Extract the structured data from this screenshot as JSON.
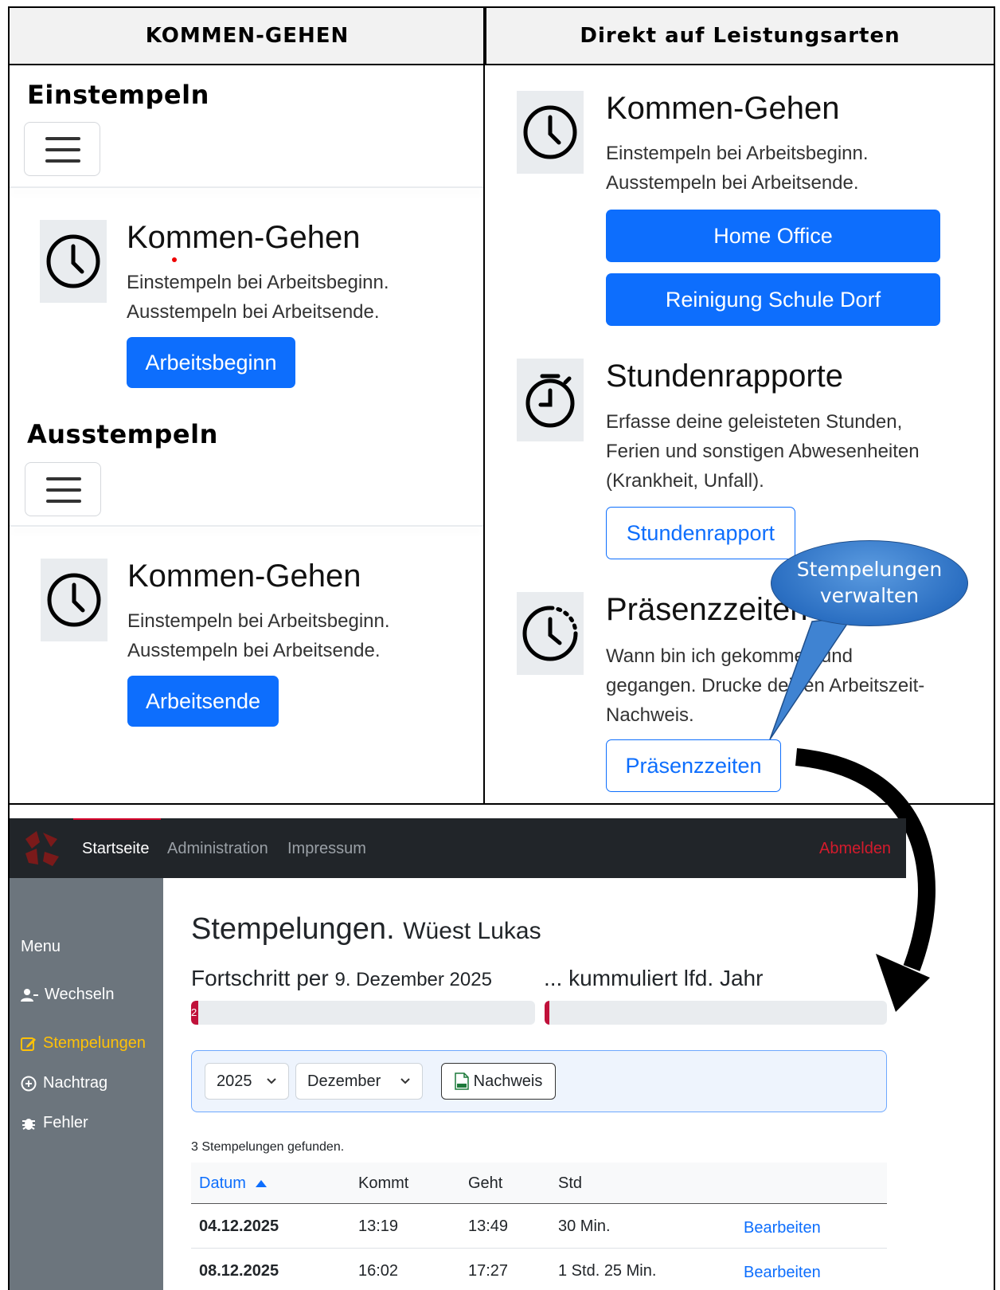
{
  "header": {
    "left": "KOMMEN-GEHEN",
    "right": "Direkt auf Leistungsarten"
  },
  "left_panel": {
    "clock_in": {
      "section_title": "Einstempeln",
      "card_title": "Kommen-Gehen",
      "text_line1": "Einstempeln bei Arbeitsbeginn.",
      "text_line2": "Ausstempeln bei Arbeitsende.",
      "button": "Arbeitsbeginn"
    },
    "clock_out": {
      "section_title": "Ausstempeln",
      "card_title": "Kommen-Gehen",
      "text_line1": "Einstempeln bei Arbeitsbeginn.",
      "text_line2": "Ausstempeln bei Arbeitsende.",
      "button": "Arbeitsende"
    }
  },
  "right_panel": {
    "kommen_gehen": {
      "title": "Kommen-Gehen",
      "text_line1": "Einstempeln bei Arbeitsbeginn.",
      "text_line2": "Ausstempeln bei Arbeitsende.",
      "button1": "Home Office",
      "button2": "Reinigung Schule Dorf"
    },
    "stundenrapporte": {
      "title": "Stundenrapporte",
      "text_line1": "Erfasse deine geleisteten Stunden,",
      "text_line2": "Ferien und sonstigen Abwesenheiten",
      "text_line3": "(Krankheit, Unfall).",
      "button": "Stundenrapport"
    },
    "praesenzzeiten": {
      "title": "Präsenzzeiten",
      "text_line1": "Wann bin ich gekommen und",
      "text_line2": "gegangen. Drucke deinen Arbeitszeit-",
      "text_line3": "Nachweis.",
      "button": "Präsenzzeiten"
    },
    "callout": {
      "line1": "Stempelungen",
      "line2": "verwalten"
    }
  },
  "app": {
    "nav": {
      "items": [
        "Startseite",
        "Administration",
        "Impressum"
      ],
      "logout": "Abmelden"
    },
    "sidebar": {
      "menu_label": "Menu",
      "items": [
        {
          "label": "Wechseln",
          "icon": "user-switch-icon"
        },
        {
          "label": "Stempelungen",
          "icon": "edit-icon"
        },
        {
          "label": "Nachtrag",
          "icon": "plus-circle-icon"
        },
        {
          "label": "Fehler",
          "icon": "bug-icon"
        }
      ]
    },
    "title": "Stempelungen.",
    "user": "Wüest Lukas",
    "progress": {
      "label": "Fortschritt per",
      "date": "9. Dezember 2025",
      "cumulative_label": "... kummuliert lfd. Jahr",
      "bar1_text": "2",
      "bar1_fraction": 0.02,
      "bar2_fraction": 0.01
    },
    "filter": {
      "year": "2025",
      "month": "Dezember",
      "export_button": "Nachweis"
    },
    "found_text": "3 Stempelungen gefunden.",
    "table": {
      "headers": [
        "Datum",
        "Kommt",
        "Geht",
        "Std"
      ],
      "rows": [
        {
          "datum": "04.12.2025",
          "kommt": "13:19",
          "geht": "13:49",
          "std": "30 Min.",
          "action": "Bearbeiten"
        },
        {
          "datum": "08.12.2025",
          "kommt": "16:02",
          "geht": "17:27",
          "std": "1 Std. 25 Min.",
          "action": "Bearbeiten"
        }
      ]
    },
    "colors": {
      "primary": "#0d6efd",
      "navbar": "#212529",
      "sidebar": "#6c757d",
      "sidebar_active": "#ffc107",
      "logout": "#d41b2c",
      "progress": "#c0113a"
    }
  }
}
